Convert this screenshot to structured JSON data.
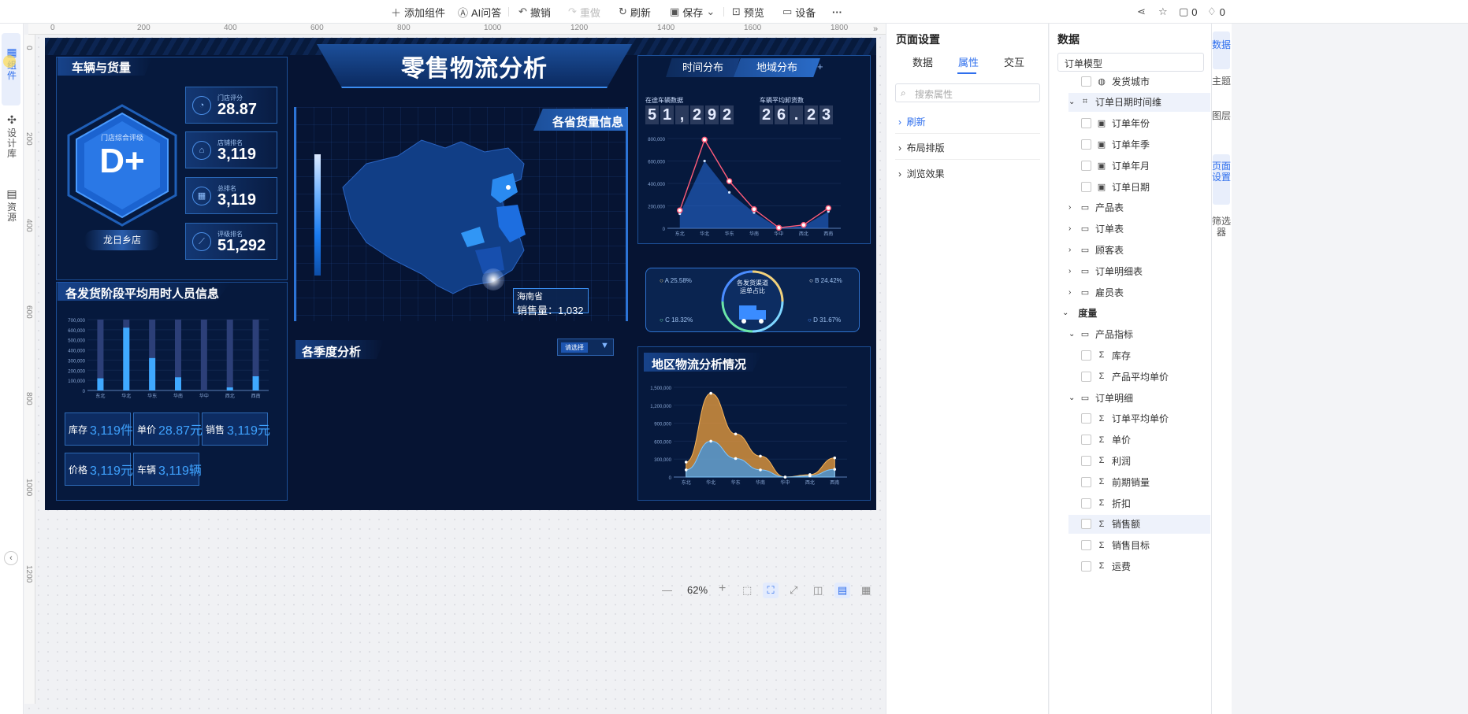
{
  "toolbar": {
    "add_component": "添加组件",
    "ai_qa": "AI问答",
    "undo": "撤销",
    "redo": "重做",
    "refresh": "刷新",
    "save": "保存",
    "preview": "预览",
    "device": "设备",
    "more": "···",
    "comment_count": "0",
    "like_count": "0"
  },
  "left_strip": {
    "components": "组件",
    "design_lib": "设计库",
    "resources": "资源"
  },
  "rulers": {
    "h": [
      "0",
      "200",
      "400",
      "600",
      "800",
      "1000",
      "1200",
      "1400",
      "1600",
      "1800"
    ],
    "v": [
      "0",
      "200",
      "400",
      "600",
      "800",
      "1000",
      "1200"
    ]
  },
  "dashboard": {
    "title": "零售物流分析",
    "vehicle_panel": {
      "title": "车辆与货量",
      "hex_caption": "门店综合评级",
      "grade": "D+",
      "store": "龙日乡店",
      "kpis": [
        {
          "label": "门店评分",
          "value": "28.87"
        },
        {
          "label": "店铺排名",
          "value": "3,119"
        },
        {
          "label": "总排名",
          "value": "3,119"
        },
        {
          "label": "评级排名",
          "value": "51,292"
        }
      ]
    },
    "stage_panel": {
      "title": "各发货阶段平均用时人员信息",
      "boxes": [
        {
          "label": "库存",
          "value": "3,119件"
        },
        {
          "label": "单价",
          "value": "28.87元"
        },
        {
          "label": "销售",
          "value": "3,119元"
        },
        {
          "label": "价格",
          "value": "3,119元"
        },
        {
          "label": "车辆",
          "value": "3,119辆"
        }
      ]
    },
    "map_panel": {
      "title": "各省货量信息",
      "tooltip_name": "海南省",
      "tooltip_value": "销售量：1,032"
    },
    "quarter_panel": {
      "title": "各季度分析",
      "select_placeholder": "请选择"
    },
    "tabs": {
      "tab1": "时间分布",
      "tab2": "地域分布",
      "add": "+"
    },
    "counters": {
      "label1": "在途车辆数据",
      "value1": [
        "5",
        "1",
        ",",
        "2",
        "9",
        "2"
      ],
      "label2": "车辆平均卸货数",
      "value2": [
        "2",
        "6",
        ".",
        "2",
        "3"
      ]
    },
    "ring": {
      "center_line1": "各发货渠道",
      "center_line2": "运单占比",
      "a": "A",
      "a_val": "25.58%",
      "b": "B",
      "b_val": "24.42%",
      "c": "C",
      "c_val": "18.32%",
      "d": "D",
      "d_val": "31.67%"
    },
    "region_panel": {
      "title": "地区物流分析情况"
    }
  },
  "chart_data": [
    {
      "type": "bar",
      "categories": [
        "东北",
        "华北",
        "华东",
        "华南",
        "华中",
        "西北",
        "西南"
      ],
      "ylim": [
        0,
        700000
      ],
      "yticks": [
        "700,000",
        "600,000",
        "500,000",
        "400,000",
        "300,000",
        "200,000",
        "100,000",
        "0"
      ],
      "series": [
        {
          "values": [
            120000,
            620000,
            320000,
            130000,
            0,
            30000,
            140000
          ]
        },
        {
          "values": [
            700000,
            700000,
            700000,
            700000,
            700000,
            700000,
            700000
          ]
        }
      ]
    },
    {
      "type": "line",
      "categories": [
        "东北",
        "华北",
        "华东",
        "华南",
        "华中",
        "西北",
        "西南"
      ],
      "ylim": [
        0,
        800000
      ],
      "yticks": [
        "800,000",
        "600,000",
        "400,000",
        "200,000",
        "0"
      ],
      "series": [
        {
          "values": [
            160000,
            790000,
            420000,
            170000,
            5000,
            30000,
            180000
          ]
        },
        {
          "values": [
            130000,
            600000,
            320000,
            140000,
            0,
            20000,
            150000
          ]
        }
      ]
    },
    {
      "type": "area",
      "categories": [
        "东北",
        "华北",
        "华东",
        "华南",
        "华中",
        "西北",
        "西南"
      ],
      "ylim": [
        0,
        1500000
      ],
      "yticks": [
        "1,500,000",
        "1,200,000",
        "900,000",
        "600,000",
        "300,000",
        "0"
      ],
      "series": [
        {
          "values": [
            250000,
            1400000,
            720000,
            350000,
            0,
            40000,
            320000
          ]
        },
        {
          "values": [
            120000,
            600000,
            310000,
            120000,
            0,
            20000,
            130000
          ]
        }
      ]
    }
  ],
  "right_panel": {
    "title": "页面设置",
    "tabs": [
      "数据",
      "属性",
      "交互"
    ],
    "active_tab": "属性",
    "search_placeholder": "搜索属性",
    "sections": [
      "刷新",
      "布局排版",
      "浏览效果"
    ]
  },
  "data_panel": {
    "title": "数据",
    "model": "订单模型",
    "items": [
      {
        "label": "发货城市",
        "indent": 1,
        "type": "field",
        "icon": "globe-icon"
      },
      {
        "label": "订单日期时间维",
        "indent": 0,
        "type": "folder-open",
        "icon": "hierarchy-icon"
      },
      {
        "label": "订单年份",
        "indent": 1,
        "type": "field",
        "icon": "date-icon"
      },
      {
        "label": "订单年季",
        "indent": 1,
        "type": "field",
        "icon": "date-icon"
      },
      {
        "label": "订单年月",
        "indent": 1,
        "type": "field",
        "icon": "date-icon"
      },
      {
        "label": "订单日期",
        "indent": 1,
        "type": "field",
        "icon": "date-icon"
      },
      {
        "label": "产品表",
        "indent": 0,
        "type": "folder",
        "icon": "folder-icon"
      },
      {
        "label": "订单表",
        "indent": 0,
        "type": "folder",
        "icon": "folder-icon"
      },
      {
        "label": "顾客表",
        "indent": 0,
        "type": "folder",
        "icon": "folder-icon"
      },
      {
        "label": "订单明细表",
        "indent": 0,
        "type": "folder",
        "icon": "folder-icon"
      },
      {
        "label": "雇员表",
        "indent": 0,
        "type": "folder",
        "icon": "folder-icon"
      },
      {
        "label": "度量",
        "indent": -1,
        "type": "group",
        "icon": ""
      },
      {
        "label": "产品指标",
        "indent": 0,
        "type": "folder-open",
        "icon": "folder-icon"
      },
      {
        "label": "库存",
        "indent": 1,
        "type": "field",
        "icon": "sigma-icon"
      },
      {
        "label": "产品平均单价",
        "indent": 1,
        "type": "field",
        "icon": "sigma-icon"
      },
      {
        "label": "订单明细",
        "indent": 0,
        "type": "folder-open",
        "icon": "folder-icon"
      },
      {
        "label": "订单平均单价",
        "indent": 1,
        "type": "field",
        "icon": "sigma-icon"
      },
      {
        "label": "单价",
        "indent": 1,
        "type": "field",
        "icon": "sigma-icon"
      },
      {
        "label": "利润",
        "indent": 1,
        "type": "field",
        "icon": "calc-sigma-icon"
      },
      {
        "label": "前期销量",
        "indent": 1,
        "type": "field",
        "icon": "calc-sigma-icon"
      },
      {
        "label": "折扣",
        "indent": 1,
        "type": "field",
        "icon": "sigma-icon"
      },
      {
        "label": "销售额",
        "indent": 1,
        "type": "field",
        "icon": "sigma-icon"
      },
      {
        "label": "销售目标",
        "indent": 1,
        "type": "field",
        "icon": "calc-sigma-icon"
      },
      {
        "label": "运费",
        "indent": 1,
        "type": "field",
        "icon": "sigma-icon"
      }
    ]
  },
  "right_strip": {
    "data": "数据",
    "theme": "主题",
    "layers": "图层",
    "page_settings": "页面设置",
    "filter": "筛选器"
  },
  "zoom": {
    "minus": "—",
    "value": "62%",
    "plus": "+"
  }
}
